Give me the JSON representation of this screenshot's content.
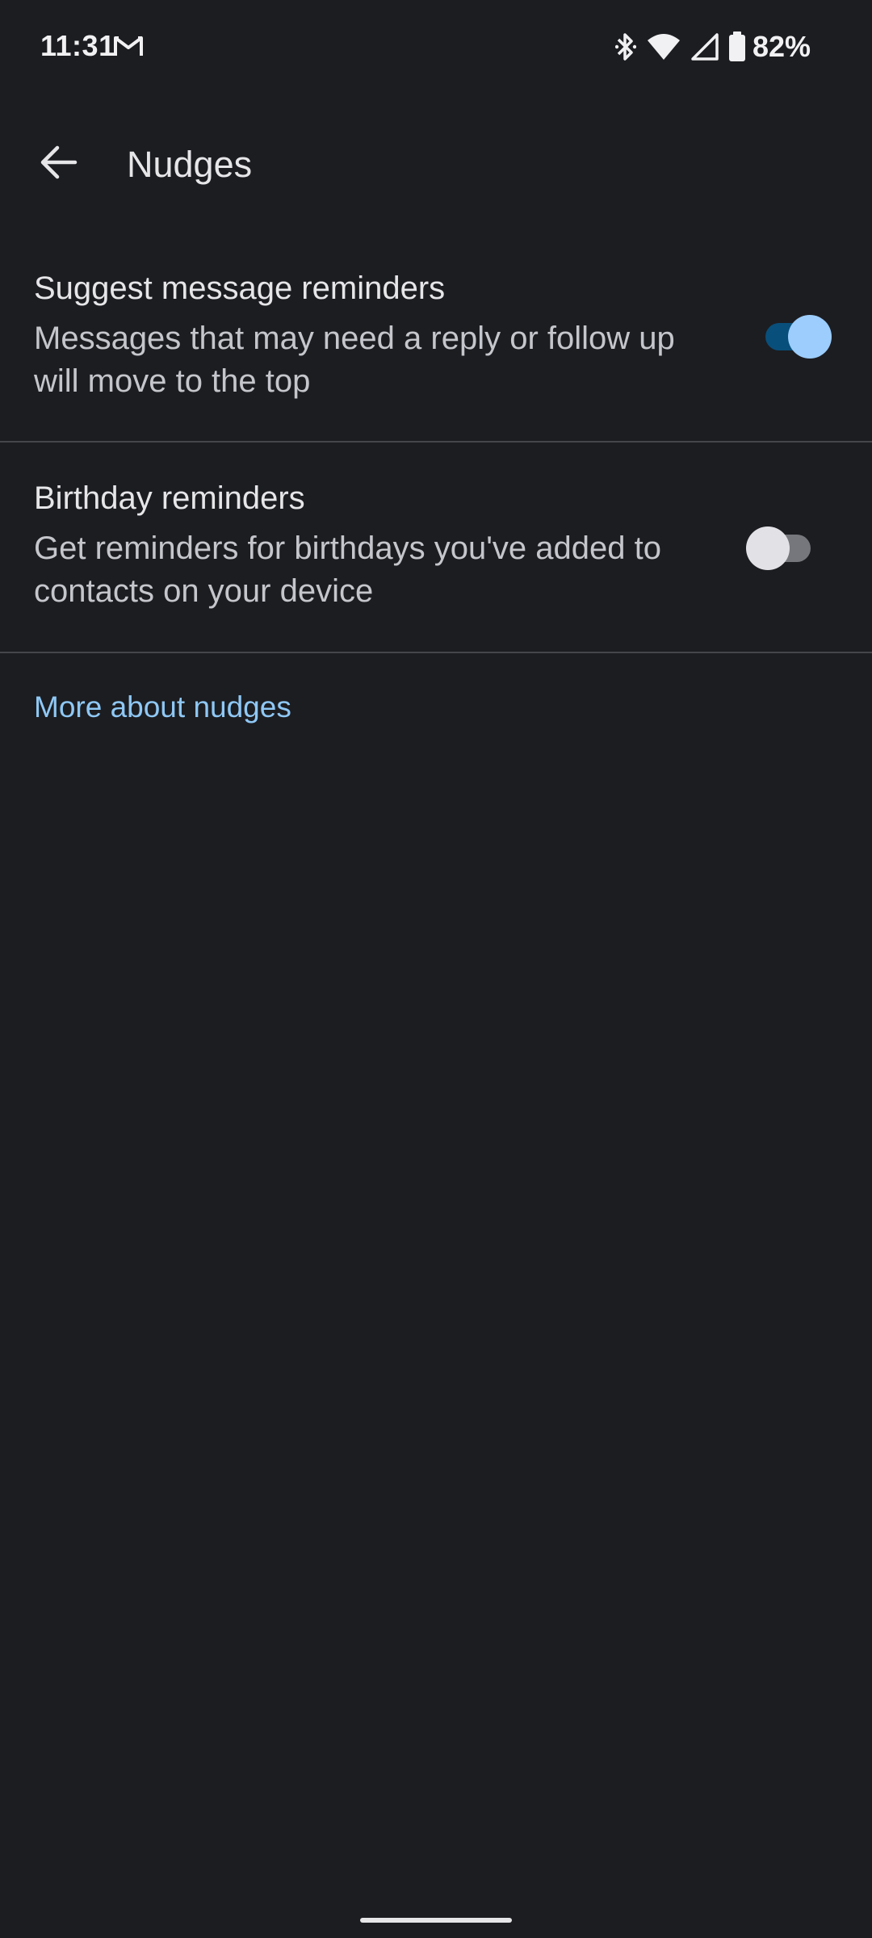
{
  "status_bar": {
    "time": "11:31",
    "battery_percent": "82%",
    "icons": [
      "gmail-icon",
      "bluetooth-icon",
      "wifi-icon",
      "signal-icon",
      "battery-icon"
    ]
  },
  "app_bar": {
    "title": "Nudges",
    "back_icon": "arrow-back-icon"
  },
  "settings": [
    {
      "title": "Suggest message reminders",
      "summary": "Messages that may need a reply or follow up will move to the top",
      "enabled": true
    },
    {
      "title": "Birthday reminders",
      "summary": "Get reminders for birthdays you've added to contacts on your device",
      "enabled": false
    }
  ],
  "link": {
    "label": "More about nudges"
  },
  "colors": {
    "background": "#1c1d21",
    "accent": "#9ccdfc",
    "link": "#8fc8f5",
    "divider": "#45464b"
  }
}
